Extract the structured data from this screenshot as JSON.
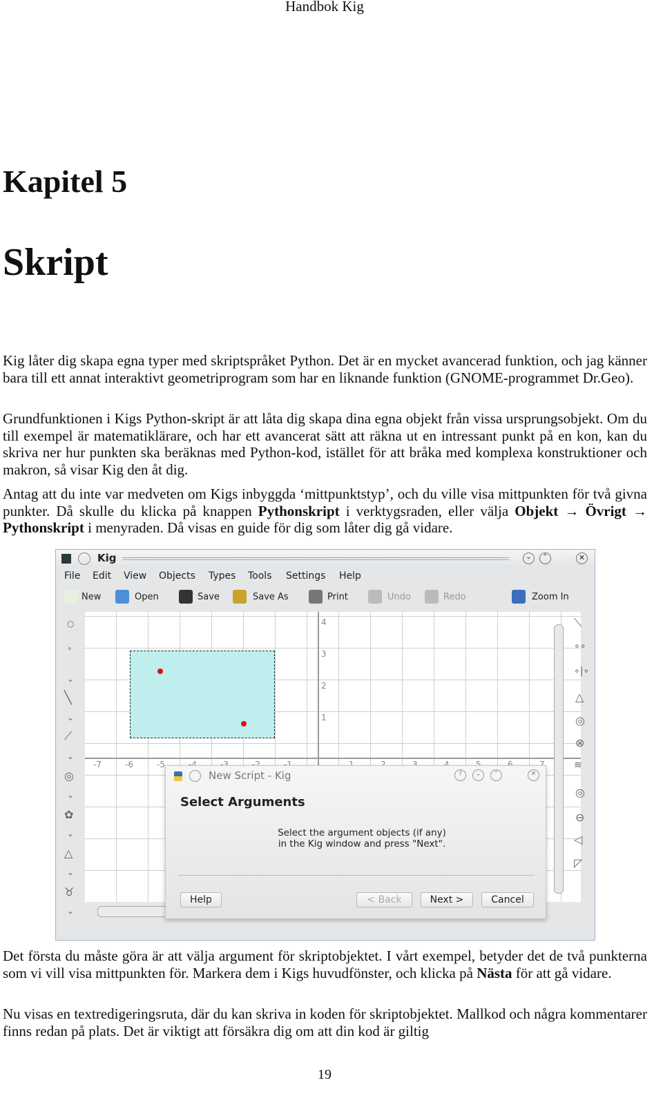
{
  "header": "Handbok Kig",
  "chapter": "Kapitel 5",
  "title": "Skript",
  "paragraphs": [
    [
      {
        "t": "Kig låter dig skapa egna typer med skriptspråket Python. Det är en mycket avancerad funktion, och jag känner bara till ett annat interaktivt geometriprogram som har en liknande funktion (GNOME-programmet Dr.Geo)."
      }
    ],
    [
      {
        "t": "Grundfunktionen i Kigs Python-skript är att låta dig skapa dina egna objekt från vissa ursprungs­objekt. Om du till exempel är matematiklärare, och har ett avancerat sätt att räkna ut en intressant punkt på en kon, kan du skriva ner hur punkten ska beräknas med Python-kod, istället för att bråka med komplexa konstruktioner och makron, så visar Kig den åt dig."
      }
    ],
    [
      {
        "t": "Antag att du inte var medveten om Kigs inbyggda ‘mittpunktstyp’, och du ville visa mittpunkten för två givna punkter. Då skulle du klicka på knappen "
      },
      {
        "t": "Pythonskript",
        "b": true
      },
      {
        "t": " i verktygsraden, eller välja "
      },
      {
        "t": "Objekt",
        "b": true
      },
      {
        "t": " → "
      },
      {
        "t": "Övrigt",
        "b": true
      },
      {
        "t": " → "
      },
      {
        "t": "Pythonskript",
        "b": true
      },
      {
        "t": " i menyraden. Då visas en guide för dig som låter dig gå vidare."
      }
    ]
  ],
  "paragraphs_after": [
    [
      {
        "t": "Det första du måste göra är att välja argument för skriptobjektet. I vårt exempel, betyder det de två punkterna som vi vill visa mittpunkten för. Markera dem i Kigs huvudfönster, och klicka på "
      },
      {
        "t": "Nästa",
        "b": true
      },
      {
        "t": " för att gå vidare."
      }
    ],
    [
      {
        "t": "Nu visas en textredigeringsruta, där du kan skriva in koden för skriptobjektet. Mallkod och några kommentarer finns redan på plats. Det är viktigt att försäkra dig om att din kod är giltig"
      }
    ]
  ],
  "page_number": "19",
  "screenshot": {
    "window_title": "Kig",
    "menu": [
      "File",
      "Edit",
      "View",
      "Objects",
      "Types",
      "Tools",
      "Settings",
      "Help"
    ],
    "toolbar": [
      {
        "label": "New",
        "icon": "new-document-icon",
        "enabled": true
      },
      {
        "label": "Open",
        "icon": "open-folder-icon",
        "enabled": true
      },
      {
        "label": "Save",
        "icon": "floppy-disk-icon",
        "enabled": true
      },
      {
        "label": "Save As",
        "icon": "save-as-icon",
        "enabled": true
      },
      {
        "label": "Print",
        "icon": "printer-icon",
        "enabled": true
      },
      {
        "label": "Undo",
        "icon": "undo-icon",
        "enabled": false
      },
      {
        "label": "Redo",
        "icon": "redo-icon",
        "enabled": false
      },
      {
        "label": "Zoom In",
        "icon": "zoom-in-icon",
        "enabled": true
      }
    ],
    "y_ticks": [
      "4",
      "3",
      "2",
      "1"
    ],
    "x_ticks": [
      "-7",
      "-6",
      "-5",
      "-4",
      "-3",
      "-2",
      "-1",
      "1",
      "2",
      "3",
      "4",
      "5",
      "6",
      "7"
    ],
    "point_color": "#dd1111",
    "selection_color": "#bfeeee",
    "dialog": {
      "title": "New Script - Kig",
      "heading": "Select Arguments",
      "message_lines": [
        "Select the argument objects (if any)",
        "in the Kig window and press \"Next\"."
      ],
      "buttons": {
        "help": "Help",
        "back": "< Back",
        "next": "Next >",
        "cancel": "Cancel"
      }
    }
  }
}
